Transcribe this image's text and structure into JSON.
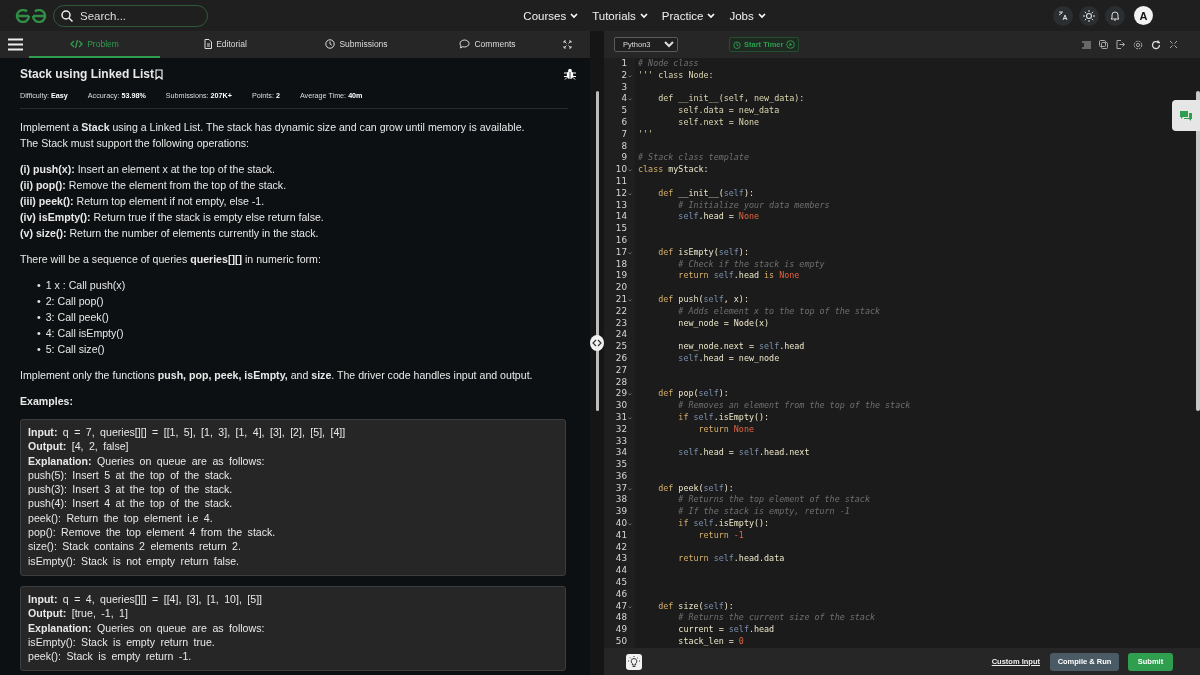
{
  "nav": {
    "search": {
      "placeholder": "Search..."
    },
    "menu": [
      {
        "label": "Courses"
      },
      {
        "label": "Tutorials"
      },
      {
        "label": "Practice"
      },
      {
        "label": "Jobs"
      }
    ],
    "avatar": "A"
  },
  "tabs": [
    {
      "label": "Problem",
      "selected": true
    },
    {
      "label": "Editorial",
      "selected": false
    },
    {
      "label": "Submissions",
      "selected": false
    },
    {
      "label": "Comments",
      "selected": false
    }
  ],
  "problem": {
    "title": "Stack using Linked List",
    "meta": [
      "Difficulty: **Easy**",
      "Accuracy: **53.98%**",
      "Submissions: **207K+**",
      "Points: **2**",
      "Average Time: **40m**"
    ],
    "blocks": [
      {
        "kind": "para",
        "lines": [
          "Implement a **Stack** using a Linked List. The stack has dynamic size and can grow until memory is available.",
          "The Stack must support the following operations:"
        ]
      },
      {
        "kind": "para",
        "lines": [
          "**(i) push(x):** Insert an element x at the top of the stack.",
          "**(ii) pop():** Remove the element from the top of the stack.",
          "**(iii) peek():** Return top element if not empty, else -1.",
          "**(iv) isEmpty():** Return true if the stack is empty else return false.",
          "**(v) size():** Return the number of elements currently in the stack."
        ]
      },
      {
        "kind": "para",
        "lines": [
          "There will be a sequence of queries **queries[][]** in numeric form:"
        ]
      },
      {
        "kind": "bullets",
        "items": [
          {
            "marker": "•",
            "text": "1 x : Call push(x)"
          },
          {
            "marker": "•",
            "text": "2: Call pop()"
          },
          {
            "marker": "•",
            "text": "3: Call peek()"
          },
          {
            "marker": "•",
            "text": "4: Call isEmpty()"
          },
          {
            "marker": "•",
            "text": "5: Call size()"
          }
        ]
      },
      {
        "kind": "para",
        "lines": [
          "Implement only the functions **push, pop, peek, isEmpty,** and **size**. The driver code handles input and output."
        ]
      },
      {
        "kind": "heading",
        "lines": [
          "Examples:"
        ]
      },
      {
        "kind": "example",
        "lines": [
          "**Input:** q = 7, queries[][] = [[1, 5], [1, 3], [1, 4], [3], [2], [5], [4]]",
          "**Output:** [4, 2, false]",
          "**Explanation:** Queries on queue are as follows:",
          "push(5): Insert 5 at the top of the stack.",
          "push(3): Insert 3 at the top of the stack.",
          "push(4): Insert 4 at the top of the stack.",
          "peek(): Return the top element i.e 4.",
          "pop(): Remove the top element 4 from the stack.",
          "size(): Stack contains 2 elements return 2.",
          "isEmpty(): Stack is not empty return false."
        ]
      },
      {
        "kind": "example",
        "lines": [
          "**Input:** q = 4, queries[][] = [[4], [3], [1, 10], [5]]",
          "**Output:** [true, -1, 1]",
          "**Explanation:** Queries on queue are as follows:",
          "isEmpty(): Stack is empty return true.",
          "peek(): Stack is empty return -1."
        ]
      }
    ]
  },
  "editor": {
    "language": "Python3",
    "timer": "Start Timer",
    "lines": [
      {
        "n": "1",
        "foldable": false,
        "code": [
          {
            "kind": "cm",
            "text": "# Node class"
          }
        ]
      },
      {
        "n": "2",
        "foldable": true,
        "code": [
          {
            "kind": "str",
            "text": "''' class Node:"
          }
        ]
      },
      {
        "n": "3",
        "foldable": false
      },
      {
        "n": "4",
        "foldable": true,
        "code": [
          {
            "kind": "str",
            "text": "    def __init__(self, new_data):"
          }
        ]
      },
      {
        "n": "5",
        "foldable": false,
        "code": [
          {
            "kind": "str",
            "text": "        self.data = new_data"
          }
        ]
      },
      {
        "n": "6",
        "foldable": false,
        "code": [
          {
            "kind": "str",
            "text": "        self.next = None"
          }
        ]
      },
      {
        "n": "7",
        "foldable": false,
        "code": [
          {
            "kind": "str",
            "text": "'''"
          }
        ]
      },
      {
        "n": "8",
        "foldable": false
      },
      {
        "n": "9",
        "foldable": false,
        "code": [
          {
            "kind": "cm",
            "text": "# Stack class template"
          }
        ]
      },
      {
        "n": "10",
        "foldable": true,
        "code": [
          {
            "kind": "kw",
            "text": "class"
          },
          {
            "kind": "pl",
            "text": " myStack:"
          }
        ]
      },
      {
        "n": "11",
        "foldable": false
      },
      {
        "n": "12",
        "foldable": true,
        "code": [
          {
            "kind": "kw",
            "text": "    def"
          },
          {
            "kind": "pl",
            "text": " __init__("
          },
          {
            "kind": "self",
            "text": "self"
          },
          {
            "kind": "pl",
            "text": "):"
          }
        ]
      },
      {
        "n": "13",
        "foldable": false,
        "code": [
          {
            "kind": "cm",
            "text": "        # Initialize your data members"
          }
        ]
      },
      {
        "n": "14",
        "foldable": false,
        "code": [
          {
            "kind": "self",
            "text": "        self"
          },
          {
            "kind": "pl",
            "text": ".head = "
          },
          {
            "kind": "none",
            "text": "None"
          }
        ]
      },
      {
        "n": "15",
        "foldable": false
      },
      {
        "n": "16",
        "foldable": false
      },
      {
        "n": "17",
        "foldable": true,
        "code": [
          {
            "kind": "kw",
            "text": "    def"
          },
          {
            "kind": "pl",
            "text": " isEmpty("
          },
          {
            "kind": "self",
            "text": "self"
          },
          {
            "kind": "pl",
            "text": "):"
          }
        ]
      },
      {
        "n": "18",
        "foldable": false,
        "code": [
          {
            "kind": "cm",
            "text": "        # Check if the stack is empty"
          }
        ]
      },
      {
        "n": "19",
        "foldable": false,
        "code": [
          {
            "kind": "kw",
            "text": "        return "
          },
          {
            "kind": "self",
            "text": "self"
          },
          {
            "kind": "pl",
            "text": ".head "
          },
          {
            "kind": "kw",
            "text": "is "
          },
          {
            "kind": "none",
            "text": "None"
          }
        ]
      },
      {
        "n": "20",
        "foldable": false
      },
      {
        "n": "21",
        "foldable": true,
        "code": [
          {
            "kind": "kw",
            "text": "    def"
          },
          {
            "kind": "pl",
            "text": " push("
          },
          {
            "kind": "self",
            "text": "self"
          },
          {
            "kind": "pl",
            "text": ", x):"
          }
        ]
      },
      {
        "n": "22",
        "foldable": false,
        "code": [
          {
            "kind": "cm",
            "text": "        # Adds element x to the top of the stack"
          }
        ]
      },
      {
        "n": "23",
        "foldable": false,
        "code": [
          {
            "kind": "pl",
            "text": "        new_node = Node(x)"
          }
        ]
      },
      {
        "n": "24",
        "foldable": false
      },
      {
        "n": "25",
        "foldable": false,
        "code": [
          {
            "kind": "pl",
            "text": "        new_node.next = "
          },
          {
            "kind": "self",
            "text": "self"
          },
          {
            "kind": "pl",
            "text": ".head"
          }
        ]
      },
      {
        "n": "26",
        "foldable": false,
        "code": [
          {
            "kind": "self",
            "text": "        self"
          },
          {
            "kind": "pl",
            "text": ".head = new_node"
          }
        ]
      },
      {
        "n": "27",
        "foldable": false
      },
      {
        "n": "28",
        "foldable": false
      },
      {
        "n": "29",
        "foldable": true,
        "code": [
          {
            "kind": "kw",
            "text": "    def"
          },
          {
            "kind": "pl",
            "text": " pop("
          },
          {
            "kind": "self",
            "text": "self"
          },
          {
            "kind": "pl",
            "text": "):"
          }
        ]
      },
      {
        "n": "30",
        "foldable": false,
        "code": [
          {
            "kind": "cm",
            "text": "        # Removes an element from the top of the stack"
          }
        ]
      },
      {
        "n": "31",
        "foldable": true,
        "code": [
          {
            "kind": "kw",
            "text": "        if "
          },
          {
            "kind": "self",
            "text": "self"
          },
          {
            "kind": "pl",
            "text": ".isEmpty():"
          }
        ]
      },
      {
        "n": "32",
        "foldable": false,
        "code": [
          {
            "kind": "kw",
            "text": "            return "
          },
          {
            "kind": "none",
            "text": "None"
          }
        ]
      },
      {
        "n": "33",
        "foldable": false
      },
      {
        "n": "34",
        "foldable": false,
        "code": [
          {
            "kind": "self",
            "text": "        self"
          },
          {
            "kind": "pl",
            "text": ".head = "
          },
          {
            "kind": "self",
            "text": "self"
          },
          {
            "kind": "pl",
            "text": ".head.next"
          }
        ]
      },
      {
        "n": "35",
        "foldable": false
      },
      {
        "n": "36",
        "foldable": false
      },
      {
        "n": "37",
        "foldable": true,
        "code": [
          {
            "kind": "kw",
            "text": "    def"
          },
          {
            "kind": "pl",
            "text": " peek("
          },
          {
            "kind": "self",
            "text": "self"
          },
          {
            "kind": "pl",
            "text": "):"
          }
        ]
      },
      {
        "n": "38",
        "foldable": false,
        "code": [
          {
            "kind": "cm",
            "text": "        # Returns the top element of the stack"
          }
        ]
      },
      {
        "n": "39",
        "foldable": false,
        "code": [
          {
            "kind": "cm",
            "text": "        # If the stack is empty, return -1"
          }
        ]
      },
      {
        "n": "40",
        "foldable": true,
        "code": [
          {
            "kind": "kw",
            "text": "        if "
          },
          {
            "kind": "self",
            "text": "self"
          },
          {
            "kind": "pl",
            "text": ".isEmpty():"
          }
        ]
      },
      {
        "n": "41",
        "foldable": false,
        "code": [
          {
            "kind": "kw",
            "text": "            return "
          },
          {
            "kind": "none",
            "text": "-1"
          }
        ]
      },
      {
        "n": "42",
        "foldable": false
      },
      {
        "n": "43",
        "foldable": false,
        "code": [
          {
            "kind": "kw",
            "text": "        return "
          },
          {
            "kind": "self",
            "text": "self"
          },
          {
            "kind": "pl",
            "text": ".head.data"
          }
        ]
      },
      {
        "n": "44",
        "foldable": false
      },
      {
        "n": "45",
        "foldable": false
      },
      {
        "n": "46",
        "foldable": false
      },
      {
        "n": "47",
        "foldable": true,
        "code": [
          {
            "kind": "kw",
            "text": "    def"
          },
          {
            "kind": "pl",
            "text": " size("
          },
          {
            "kind": "self",
            "text": "self"
          },
          {
            "kind": "pl",
            "text": "):"
          }
        ]
      },
      {
        "n": "48",
        "foldable": false,
        "code": [
          {
            "kind": "cm",
            "text": "        # Returns the current size of the stack"
          }
        ]
      },
      {
        "n": "49",
        "foldable": false,
        "code": [
          {
            "kind": "pl",
            "text": "        current = "
          },
          {
            "kind": "self",
            "text": "self"
          },
          {
            "kind": "pl",
            "text": ".head"
          }
        ]
      },
      {
        "n": "50",
        "foldable": false,
        "code": [
          {
            "kind": "pl",
            "text": "        stack_len = "
          },
          {
            "kind": "none",
            "text": "0"
          }
        ]
      }
    ]
  },
  "footer": {
    "custom_input": "Custom Input",
    "compile": "Compile & Run",
    "submit": "Submit"
  }
}
